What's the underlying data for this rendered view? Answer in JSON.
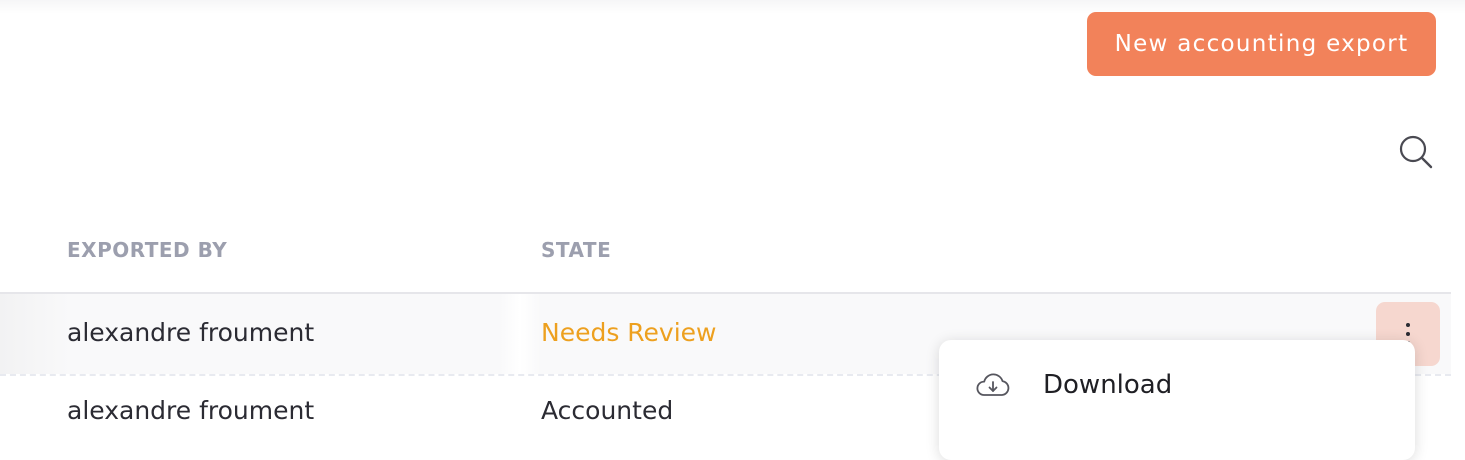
{
  "toolbar": {
    "new_export_label": "New accounting export"
  },
  "search": {
    "icon": "search-icon"
  },
  "table": {
    "columns": [
      "EXPORTED BY",
      "STATE"
    ],
    "rows": [
      {
        "exported_by": "alexandre froument",
        "state": "Needs Review"
      },
      {
        "exported_by": "alexandre froument",
        "state": "Accounted"
      }
    ]
  },
  "row_menu": {
    "icon": "more-vertical-icon",
    "items": [
      {
        "label": "Download",
        "icon": "cloud-download-icon"
      }
    ]
  },
  "colors": {
    "accent": "#f2825a",
    "needs_review": "#eda01f",
    "header_text": "#9c9fae",
    "kebab_bg": "#f6d7cf"
  }
}
